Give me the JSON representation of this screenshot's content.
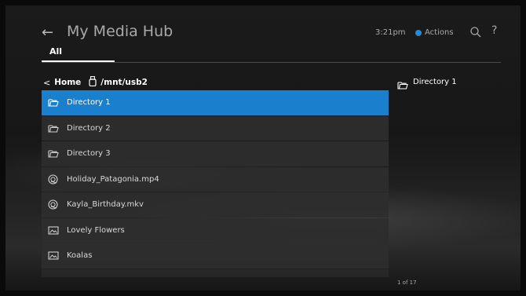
{
  "header": {
    "title": "My Media Hub",
    "time": "3:21pm",
    "actions_label": "Actions",
    "actions_color": "#2a88d8",
    "back_icon": "back-arrow-icon",
    "search_icon": "search-icon",
    "help_icon": "help-icon"
  },
  "tabs": [
    {
      "label": "All",
      "active": true
    }
  ],
  "breadcrumb": {
    "home_label": "Home",
    "device_icon": "usb-drive-icon",
    "path": "/mnt/usb2"
  },
  "list": {
    "selected_color": "#1a7fcd",
    "items": [
      {
        "label": "Directory 1",
        "icon": "folder-icon",
        "selected": true
      },
      {
        "label": "Directory 2",
        "icon": "folder-icon",
        "selected": false
      },
      {
        "label": "Directory 3",
        "icon": "folder-icon",
        "selected": false
      },
      {
        "label": "Holiday_Patagonia.mp4",
        "icon": "video-file-icon",
        "selected": false
      },
      {
        "label": "Kayla_Birthday.mkv",
        "icon": "video-file-icon",
        "selected": false
      },
      {
        "label": "Lovely Flowers",
        "icon": "photo-album-icon",
        "selected": false
      },
      {
        "label": "Koalas",
        "icon": "photo-album-icon",
        "selected": false
      }
    ]
  },
  "preview": {
    "label": "Directory 1",
    "icon": "folder-icon"
  },
  "pager": {
    "text": "1 of 17"
  }
}
